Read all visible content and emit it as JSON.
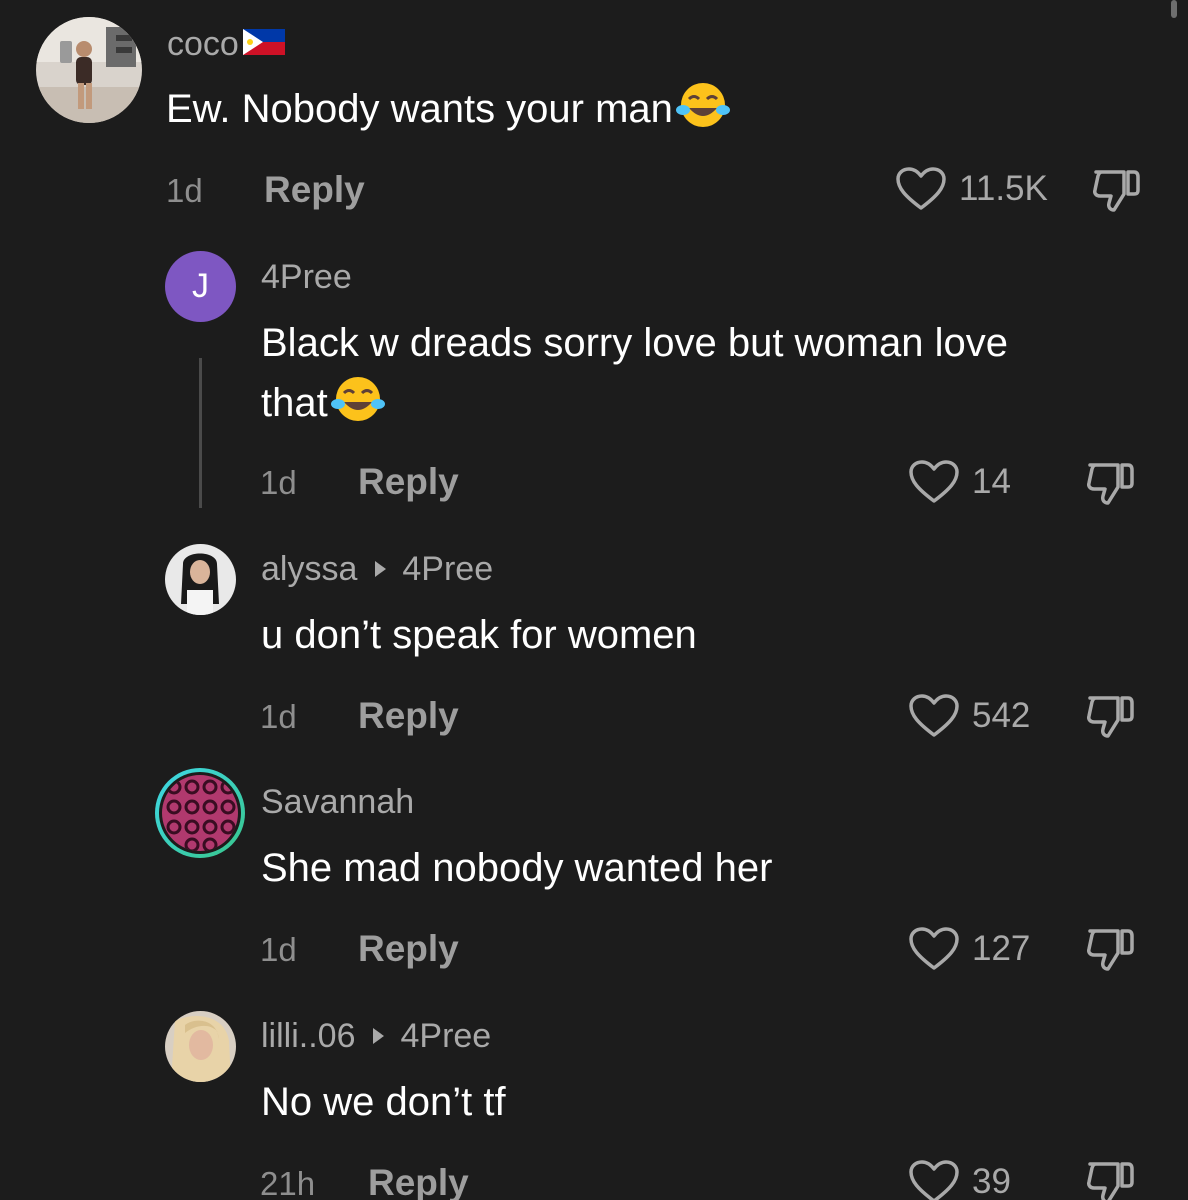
{
  "reply_label": "Reply",
  "comments": [
    {
      "username": "coco",
      "flag": "philippines-flag",
      "text": "Ew. Nobody wants your man",
      "emoji": "face-with-tears-of-joy",
      "time": "1d",
      "likes": "11.5K",
      "avatar": "photo"
    },
    {
      "username": "4Pree",
      "avatar_letter": "J",
      "avatar_color": "#7e57c2",
      "text_line1": "Black w dreads sorry love but woman love",
      "text_line2": "that",
      "emoji": "face-with-tears-of-joy",
      "time": "1d",
      "likes": "14"
    },
    {
      "username": "alyssa",
      "replying_to": "4Pree",
      "text": "u don’t speak for women",
      "time": "1d",
      "likes": "542",
      "avatar": "photo"
    },
    {
      "username": "Savannah",
      "text": "She mad nobody wanted her",
      "time": "1d",
      "likes": "127",
      "avatar": "pattern"
    },
    {
      "username": "lilli..06",
      "replying_to": "4Pree",
      "text": "No we don’t tf",
      "time": "21h",
      "likes": "39",
      "avatar": "photo"
    }
  ],
  "colors": {
    "background": "#1c1c1c",
    "text_primary": "#ffffff",
    "text_secondary": "#a9a9a9",
    "avatar_purple": "#7e57c2"
  }
}
